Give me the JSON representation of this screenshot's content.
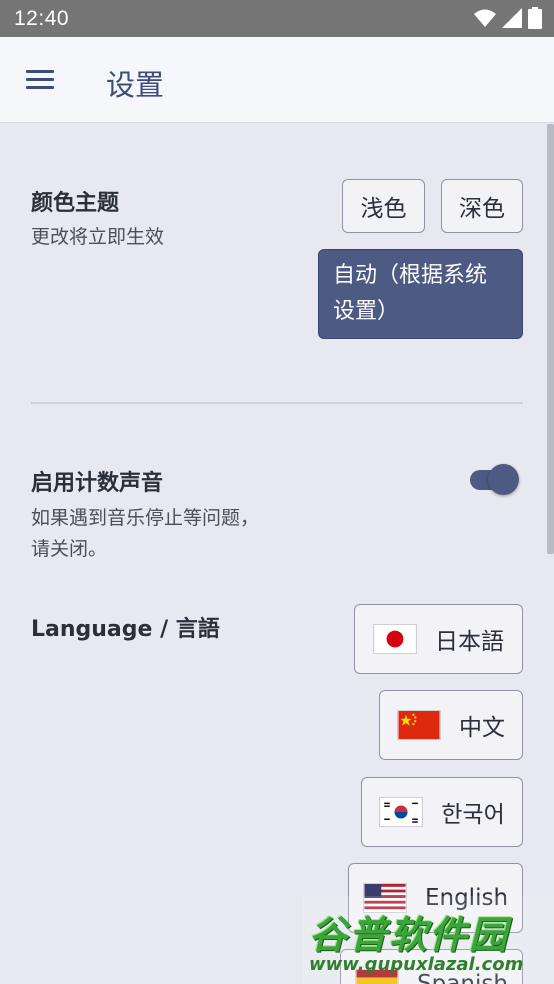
{
  "status_bar": {
    "time": "12:40"
  },
  "app_bar": {
    "title": "设置"
  },
  "theme": {
    "title": "颜色主题",
    "subtitle": "更改将立即生效",
    "options": [
      "浅色",
      "深色"
    ],
    "auto_line1": "自动（根据系统",
    "auto_line2": "设置）",
    "selected": "自动（根据系统设置）"
  },
  "sound": {
    "title": "启用计数声音",
    "subtitle_line1": "如果遇到音乐停止等问题，",
    "subtitle_line2": "请关闭。",
    "enabled": true
  },
  "language": {
    "title": "Language / 言語",
    "options": [
      {
        "label": "日本語",
        "flag": "jp"
      },
      {
        "label": "中文",
        "flag": "cn"
      },
      {
        "label": "한국어",
        "flag": "kr"
      },
      {
        "label": "English",
        "flag": "us"
      },
      {
        "label": "Spanish",
        "flag": "es"
      }
    ]
  },
  "watermark": {
    "title": "谷普软件园",
    "url": "www.gupuxlazal.com"
  },
  "colors": {
    "accent": "#4d5a84",
    "background": "#e8e8f0",
    "app_bar": "#f6f7fb",
    "status_bar": "#757575"
  }
}
